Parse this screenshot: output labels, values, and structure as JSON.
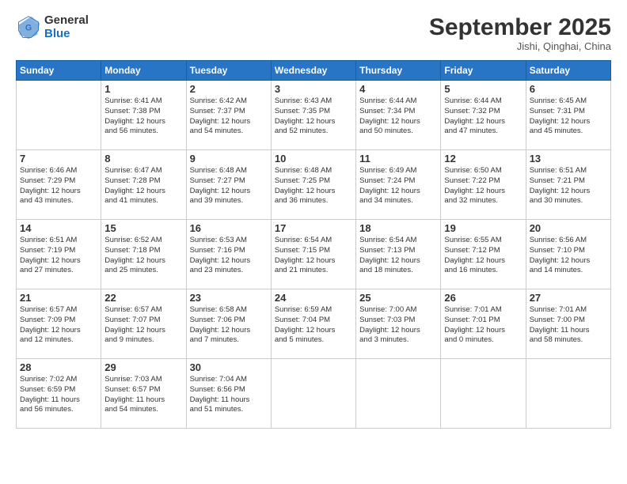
{
  "header": {
    "logo_general": "General",
    "logo_blue": "Blue",
    "month": "September 2025",
    "location": "Jishi, Qinghai, China"
  },
  "days_of_week": [
    "Sunday",
    "Monday",
    "Tuesday",
    "Wednesday",
    "Thursday",
    "Friday",
    "Saturday"
  ],
  "weeks": [
    [
      {
        "day": "",
        "info": ""
      },
      {
        "day": "1",
        "info": "Sunrise: 6:41 AM\nSunset: 7:38 PM\nDaylight: 12 hours\nand 56 minutes."
      },
      {
        "day": "2",
        "info": "Sunrise: 6:42 AM\nSunset: 7:37 PM\nDaylight: 12 hours\nand 54 minutes."
      },
      {
        "day": "3",
        "info": "Sunrise: 6:43 AM\nSunset: 7:35 PM\nDaylight: 12 hours\nand 52 minutes."
      },
      {
        "day": "4",
        "info": "Sunrise: 6:44 AM\nSunset: 7:34 PM\nDaylight: 12 hours\nand 50 minutes."
      },
      {
        "day": "5",
        "info": "Sunrise: 6:44 AM\nSunset: 7:32 PM\nDaylight: 12 hours\nand 47 minutes."
      },
      {
        "day": "6",
        "info": "Sunrise: 6:45 AM\nSunset: 7:31 PM\nDaylight: 12 hours\nand 45 minutes."
      }
    ],
    [
      {
        "day": "7",
        "info": "Sunrise: 6:46 AM\nSunset: 7:29 PM\nDaylight: 12 hours\nand 43 minutes."
      },
      {
        "day": "8",
        "info": "Sunrise: 6:47 AM\nSunset: 7:28 PM\nDaylight: 12 hours\nand 41 minutes."
      },
      {
        "day": "9",
        "info": "Sunrise: 6:48 AM\nSunset: 7:27 PM\nDaylight: 12 hours\nand 39 minutes."
      },
      {
        "day": "10",
        "info": "Sunrise: 6:48 AM\nSunset: 7:25 PM\nDaylight: 12 hours\nand 36 minutes."
      },
      {
        "day": "11",
        "info": "Sunrise: 6:49 AM\nSunset: 7:24 PM\nDaylight: 12 hours\nand 34 minutes."
      },
      {
        "day": "12",
        "info": "Sunrise: 6:50 AM\nSunset: 7:22 PM\nDaylight: 12 hours\nand 32 minutes."
      },
      {
        "day": "13",
        "info": "Sunrise: 6:51 AM\nSunset: 7:21 PM\nDaylight: 12 hours\nand 30 minutes."
      }
    ],
    [
      {
        "day": "14",
        "info": "Sunrise: 6:51 AM\nSunset: 7:19 PM\nDaylight: 12 hours\nand 27 minutes."
      },
      {
        "day": "15",
        "info": "Sunrise: 6:52 AM\nSunset: 7:18 PM\nDaylight: 12 hours\nand 25 minutes."
      },
      {
        "day": "16",
        "info": "Sunrise: 6:53 AM\nSunset: 7:16 PM\nDaylight: 12 hours\nand 23 minutes."
      },
      {
        "day": "17",
        "info": "Sunrise: 6:54 AM\nSunset: 7:15 PM\nDaylight: 12 hours\nand 21 minutes."
      },
      {
        "day": "18",
        "info": "Sunrise: 6:54 AM\nSunset: 7:13 PM\nDaylight: 12 hours\nand 18 minutes."
      },
      {
        "day": "19",
        "info": "Sunrise: 6:55 AM\nSunset: 7:12 PM\nDaylight: 12 hours\nand 16 minutes."
      },
      {
        "day": "20",
        "info": "Sunrise: 6:56 AM\nSunset: 7:10 PM\nDaylight: 12 hours\nand 14 minutes."
      }
    ],
    [
      {
        "day": "21",
        "info": "Sunrise: 6:57 AM\nSunset: 7:09 PM\nDaylight: 12 hours\nand 12 minutes."
      },
      {
        "day": "22",
        "info": "Sunrise: 6:57 AM\nSunset: 7:07 PM\nDaylight: 12 hours\nand 9 minutes."
      },
      {
        "day": "23",
        "info": "Sunrise: 6:58 AM\nSunset: 7:06 PM\nDaylight: 12 hours\nand 7 minutes."
      },
      {
        "day": "24",
        "info": "Sunrise: 6:59 AM\nSunset: 7:04 PM\nDaylight: 12 hours\nand 5 minutes."
      },
      {
        "day": "25",
        "info": "Sunrise: 7:00 AM\nSunset: 7:03 PM\nDaylight: 12 hours\nand 3 minutes."
      },
      {
        "day": "26",
        "info": "Sunrise: 7:01 AM\nSunset: 7:01 PM\nDaylight: 12 hours\nand 0 minutes."
      },
      {
        "day": "27",
        "info": "Sunrise: 7:01 AM\nSunset: 7:00 PM\nDaylight: 11 hours\nand 58 minutes."
      }
    ],
    [
      {
        "day": "28",
        "info": "Sunrise: 7:02 AM\nSunset: 6:59 PM\nDaylight: 11 hours\nand 56 minutes."
      },
      {
        "day": "29",
        "info": "Sunrise: 7:03 AM\nSunset: 6:57 PM\nDaylight: 11 hours\nand 54 minutes."
      },
      {
        "day": "30",
        "info": "Sunrise: 7:04 AM\nSunset: 6:56 PM\nDaylight: 11 hours\nand 51 minutes."
      },
      {
        "day": "",
        "info": ""
      },
      {
        "day": "",
        "info": ""
      },
      {
        "day": "",
        "info": ""
      },
      {
        "day": "",
        "info": ""
      }
    ]
  ]
}
